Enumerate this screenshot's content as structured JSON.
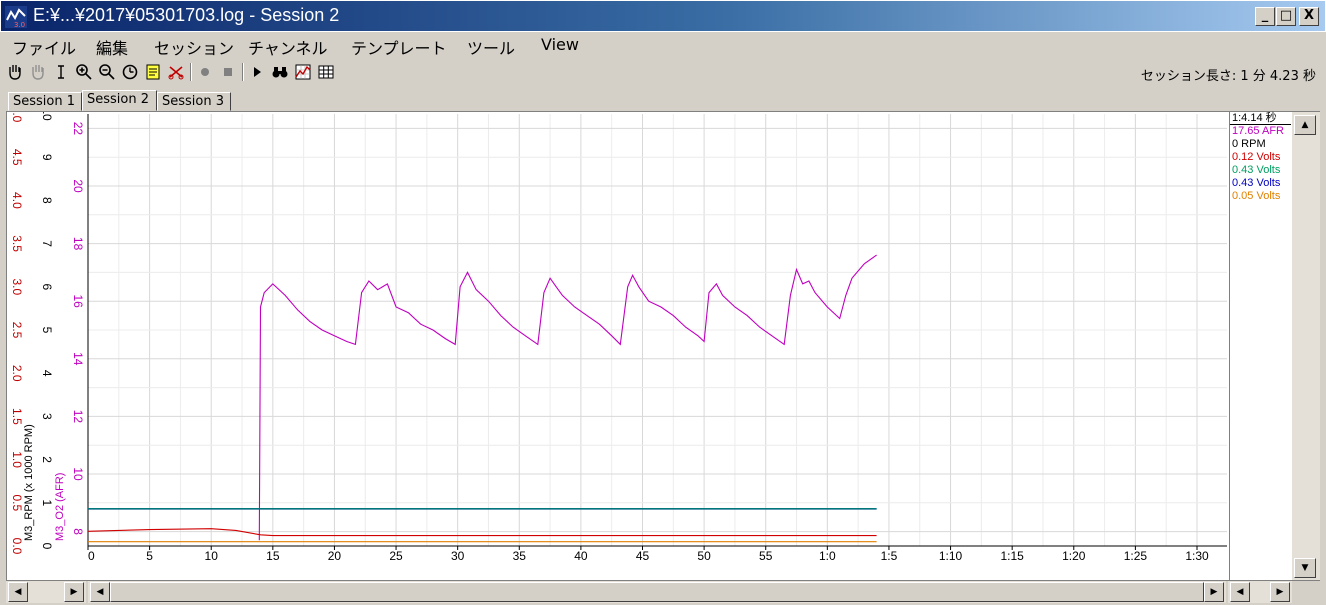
{
  "window": {
    "title": "E:¥...¥2017¥05301703.log - Session 2",
    "min": "_",
    "max": "□",
    "close": "X"
  },
  "menu": [
    "ファイル",
    "編集",
    "セッション",
    "チャンネル",
    "テンプレート",
    "ツール",
    "View"
  ],
  "toolbar": {
    "icons": [
      "hand-icon",
      "hand-disabled-icon",
      "cursor-i-icon",
      "zoom-in-icon",
      "zoom-out-icon",
      "zoom-reset-icon",
      "note-icon",
      "cut-icon",
      "record-icon",
      "stop-icon",
      "play-icon",
      "binoculars-icon",
      "chart-icon",
      "grid-icon"
    ]
  },
  "session_length": "セッション長さ:  1  分  4.23  秒",
  "tabs": [
    "Session 1",
    "Session 2",
    "Session 3"
  ],
  "active_tab": 1,
  "legend": {
    "time": "1:4.14 秒",
    "items": [
      {
        "text": "17.65 AFR",
        "color": "#c000c0"
      },
      {
        "text": "0 RPM",
        "color": "#000000"
      },
      {
        "text": "0.12 Volts",
        "color": "#d00000"
      },
      {
        "text": "0.43 Volts",
        "color": "#00a060"
      },
      {
        "text": "0.43 Volts",
        "color": "#0000c0"
      },
      {
        "text": "0.05 Volts",
        "color": "#e08000"
      }
    ]
  },
  "chart_data": {
    "type": "line",
    "x_ticks": [
      "0",
      "5",
      "10",
      "15",
      "20",
      "25",
      "30",
      "35",
      "40",
      "45",
      "50",
      "55",
      "1:0",
      "1:5",
      "1:10",
      "1:15",
      "1:20",
      "1:25",
      "1:30"
    ],
    "xlim": [
      0,
      94
    ],
    "grid": true,
    "axes": [
      {
        "label": "",
        "color": "#c00000",
        "ticks": [
          "0.0",
          "0.5",
          "1.0",
          "1.5",
          "2.0",
          "2.5",
          "3.0",
          "3.5",
          "4.0",
          "4.5",
          "5.0"
        ],
        "range": [
          0,
          5
        ]
      },
      {
        "label": "M3_RPM (x 1000 RPM)",
        "color": "#000000",
        "ticks": [
          "0",
          "1",
          "2",
          "3",
          "4",
          "5",
          "6",
          "7",
          "8",
          "9",
          "10"
        ],
        "range": [
          0,
          10
        ]
      },
      {
        "label": "M3_O2 (AFR)",
        "color": "#c000c0",
        "ticks": [
          "8",
          "10",
          "12",
          "14",
          "16",
          "18",
          "20",
          "22"
        ],
        "range": [
          7.5,
          22.5
        ]
      }
    ],
    "series": [
      {
        "color": "#c000c0",
        "axis": 2,
        "x": [
          13.9,
          14.0,
          14.3,
          15.0,
          16.0,
          17.0,
          18.0,
          19.0,
          20.0,
          21.0,
          21.7,
          22.2,
          22.8,
          23.5,
          24.3,
          25.0,
          26.0,
          27.0,
          28.0,
          29.0,
          29.8,
          30.2,
          30.8,
          31.5,
          32.5,
          33.5,
          34.5,
          35.5,
          36.5,
          37.0,
          37.5,
          38.0,
          38.5,
          39.5,
          40.5,
          41.5,
          42.5,
          43.2,
          43.8,
          44.2,
          44.7,
          45.5,
          46.5,
          47.5,
          48.5,
          49.5,
          50.0,
          50.4,
          51.0,
          51.5,
          52.5,
          53.5,
          54.5,
          55.5,
          56.5,
          57.0,
          57.5,
          58.0,
          58.5,
          59.0,
          60.0,
          61.0,
          61.5,
          62.0,
          63.0,
          64.0
        ],
        "y": [
          7.7,
          15.8,
          16.3,
          16.6,
          16.2,
          15.7,
          15.3,
          15.0,
          14.8,
          14.6,
          14.5,
          16.3,
          16.7,
          16.4,
          16.6,
          15.8,
          15.6,
          15.2,
          15.0,
          14.7,
          14.5,
          16.5,
          17.0,
          16.4,
          16.0,
          15.5,
          15.1,
          14.8,
          14.5,
          16.3,
          16.8,
          16.5,
          16.2,
          15.8,
          15.5,
          15.2,
          14.8,
          14.5,
          16.5,
          16.9,
          16.5,
          16.0,
          15.8,
          15.5,
          15.1,
          14.8,
          14.6,
          16.3,
          16.6,
          16.2,
          15.8,
          15.5,
          15.1,
          14.8,
          14.5,
          16.2,
          17.1,
          16.6,
          16.7,
          16.3,
          15.8,
          15.4,
          16.2,
          16.8,
          17.3,
          17.6
        ]
      },
      {
        "color": "#0000c0",
        "axis": 0,
        "x": [
          0,
          64
        ],
        "y": [
          0.43,
          0.43
        ]
      },
      {
        "color": "#00a060",
        "axis": 0,
        "x": [
          0,
          64
        ],
        "y": [
          0.43,
          0.43
        ]
      },
      {
        "color": "#d00000",
        "axis": 0,
        "x": [
          0,
          5,
          10,
          12,
          14,
          15,
          20,
          30,
          40,
          50,
          64
        ],
        "y": [
          0.17,
          0.19,
          0.2,
          0.18,
          0.13,
          0.12,
          0.12,
          0.12,
          0.12,
          0.12,
          0.12
        ]
      },
      {
        "color": "#e08000",
        "axis": 0,
        "x": [
          0,
          64
        ],
        "y": [
          0.05,
          0.05
        ]
      },
      {
        "color": "#000000",
        "axis": 1,
        "x": [
          0,
          64
        ],
        "y": [
          0,
          0
        ]
      }
    ]
  },
  "colors": {
    "title_start": "#0a246a",
    "title_end": "#a6caf0",
    "face": "#d4d0c8"
  }
}
